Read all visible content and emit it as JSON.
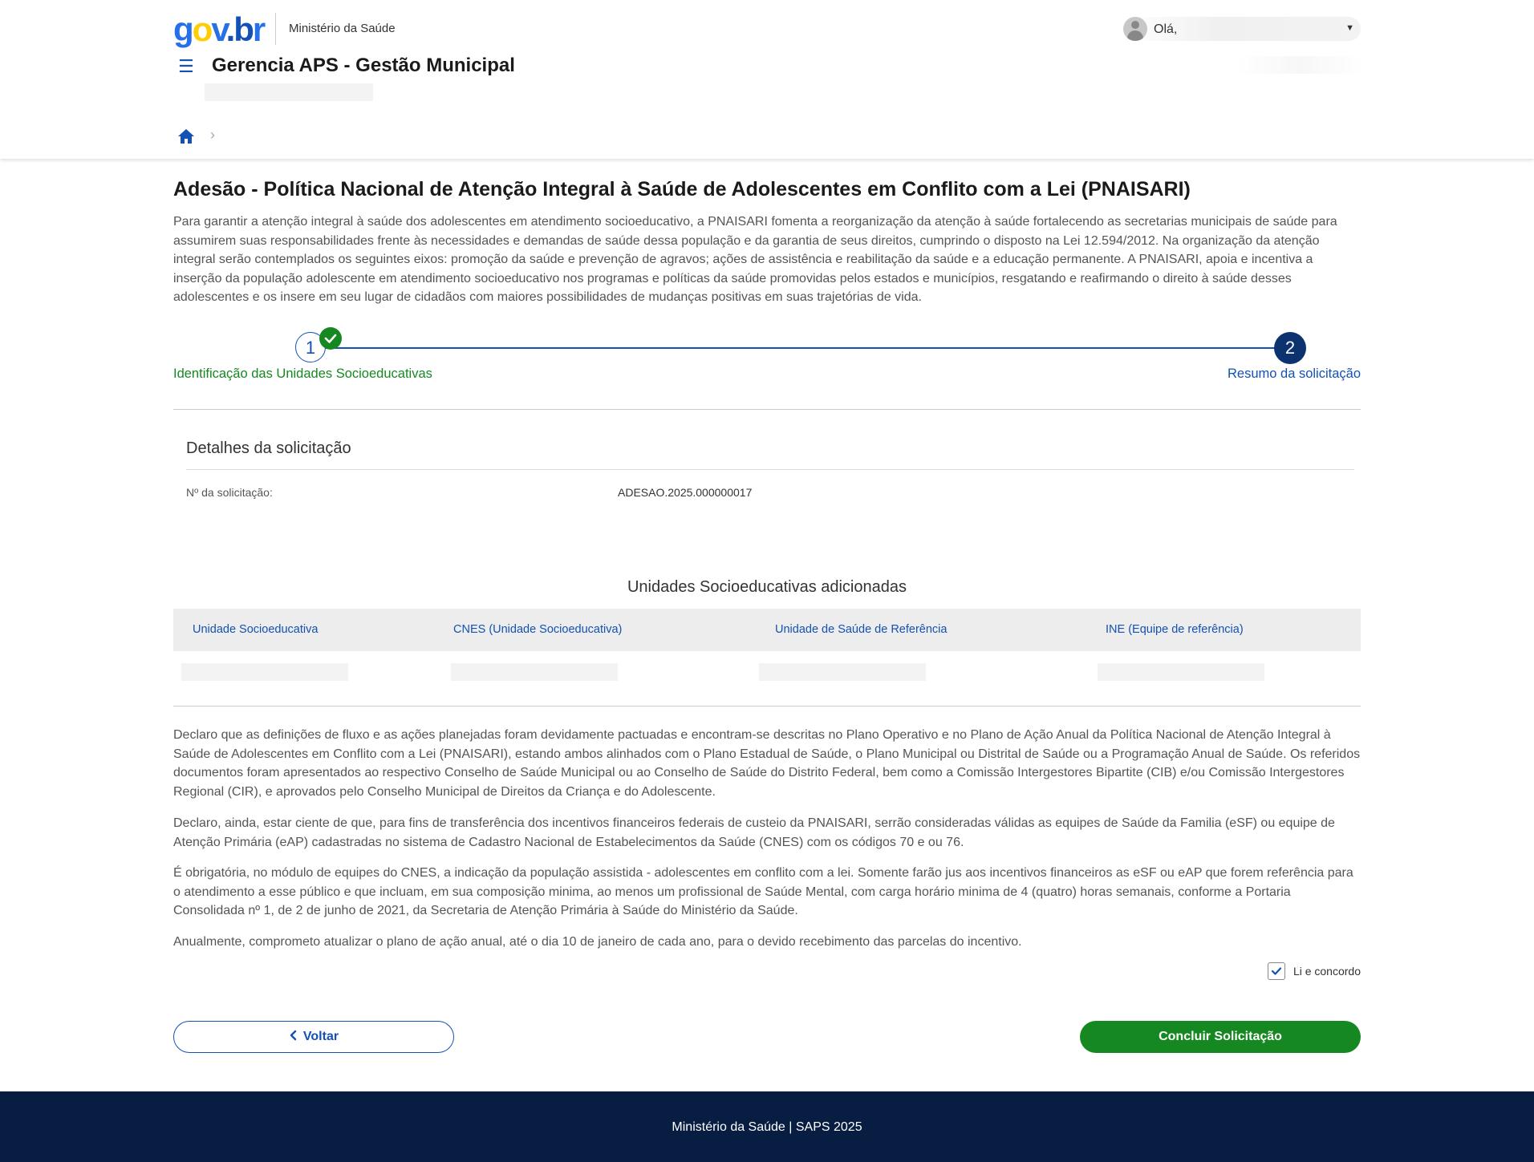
{
  "header": {
    "logo": {
      "g": "g",
      "o": "o",
      "v": "v",
      "dot": ".",
      "b": "b",
      "r": "r"
    },
    "ministry": "Ministério da Saúde",
    "user_greeting": "Olá,",
    "app_title": "Gerencia APS - Gestão Municipal",
    "breadcrumb_separator": "›"
  },
  "page": {
    "title": "Adesão - Política Nacional de Atenção Integral à Saúde de Adolescentes em Conflito com a Lei (PNAISARI)",
    "intro": "Para garantir a atenção integral à saúde dos adolescentes em atendimento socioeducativo, a PNAISARI fomenta a reorganização da atenção à saúde fortalecendo as secretarias municipais de saúde para assumirem suas responsabilidades frente às necessidades e demandas de saúde dessa população e da garantia de seus direitos, cumprindo o disposto na Lei 12.594/2012. Na organização da atenção integral serão contemplados os seguintes eixos: promoção da saúde e prevenção de agravos; ações de assistência e reabilitação da saúde e a educação permanente. A PNAISARI, apoia e incentiva a inserção da população adolescente em atendimento socioeducativo nos programas e políticas da saúde promovidas pelos estados e municípios, resgatando e reafirmando o direito à saúde desses adolescentes e os insere em seu lugar de cidadãos com maiores possibilidades de mudanças positivas em suas trajetórias de vida."
  },
  "stepper": {
    "steps": [
      {
        "number": "1",
        "label": "Identificação das Unidades Socioeducativas",
        "status": "completed"
      },
      {
        "number": "2",
        "label": "Resumo da solicitação",
        "status": "current"
      }
    ]
  },
  "details": {
    "title": "Detalhes da solicitação",
    "request_number_label": "Nº da solicitação:",
    "request_number_value": "ADESAO.2025.000000017"
  },
  "units_table": {
    "title": "Unidades Socioeducativas adicionadas",
    "columns": [
      "Unidade Socioeducativa",
      "CNES (Unidade Socioeducativa)",
      "Unidade de Saúde de Referência",
      "INE (Equipe de referência)"
    ]
  },
  "declarations": [
    "Declaro que as definições de fluxo e as ações planejadas foram devidamente pactuadas e encontram-se descritas no Plano Operativo e no Plano de Ação Anual da Política Nacional de Atenção Integral à Saúde de Adolescentes em Conflito com a Lei (PNAISARI), estando ambos alinhados com o Plano Estadual de Saúde, o Plano Municipal ou Distrital de Saúde ou a Programação Anual de Saúde. Os referidos documentos foram apresentados ao respectivo Conselho de Saúde Municipal ou ao Conselho de Saúde do Distrito Federal, bem como a Comissão Intergestores Bipartite (CIB) e/ou Comissão Intergestores Regional (CIR), e aprovados pelo Conselho Municipal de Direitos da Criança e do Adolescente.",
    "Declaro, ainda, estar ciente de que, para fins de transferência dos incentivos financeiros federais de custeio da PNAISARI, serrão consideradas válidas as equipes de Saúde da Familia (eSF) ou equipe de Atenção Primária (eAP) cadastradas no sistema de Cadastro Nacional de Estabelecimentos da Saúde (CNES) com os códigos 70 e ou 76.",
    "É obrigatória, no módulo de equipes do CNES, a indicação da população assistida - adolescentes em conflito com a lei. Somente farão jus aos incentivos financeiros as eSF ou eAP que forem referência para o atendimento a esse público e que incluam, em sua composição minima, ao menos um profissional de Saúde Mental, com carga horário minima de 4 (quatro) horas semanais, conforme a Portaria Consolidada nº 1, de 2 de junho de 2021, da Secretaria de Atenção Primária à Saúde do Ministério da Saúde.",
    "Anualmente, comprometo atualizar o plano de ação anual, até o dia 10 de janeiro de cada ano, para o devido recebimento das parcelas do incentivo."
  ],
  "agreement": {
    "label": "Li e concordo",
    "checked": true
  },
  "actions": {
    "back": "Voltar",
    "submit": "Concluir Solicitação"
  },
  "footer": {
    "text": "Ministério da Saúde | SAPS 2025"
  },
  "colors": {
    "primary": "#1351b4",
    "success": "#168821",
    "dark_blue": "#0c326f",
    "footer": "#071d41"
  }
}
